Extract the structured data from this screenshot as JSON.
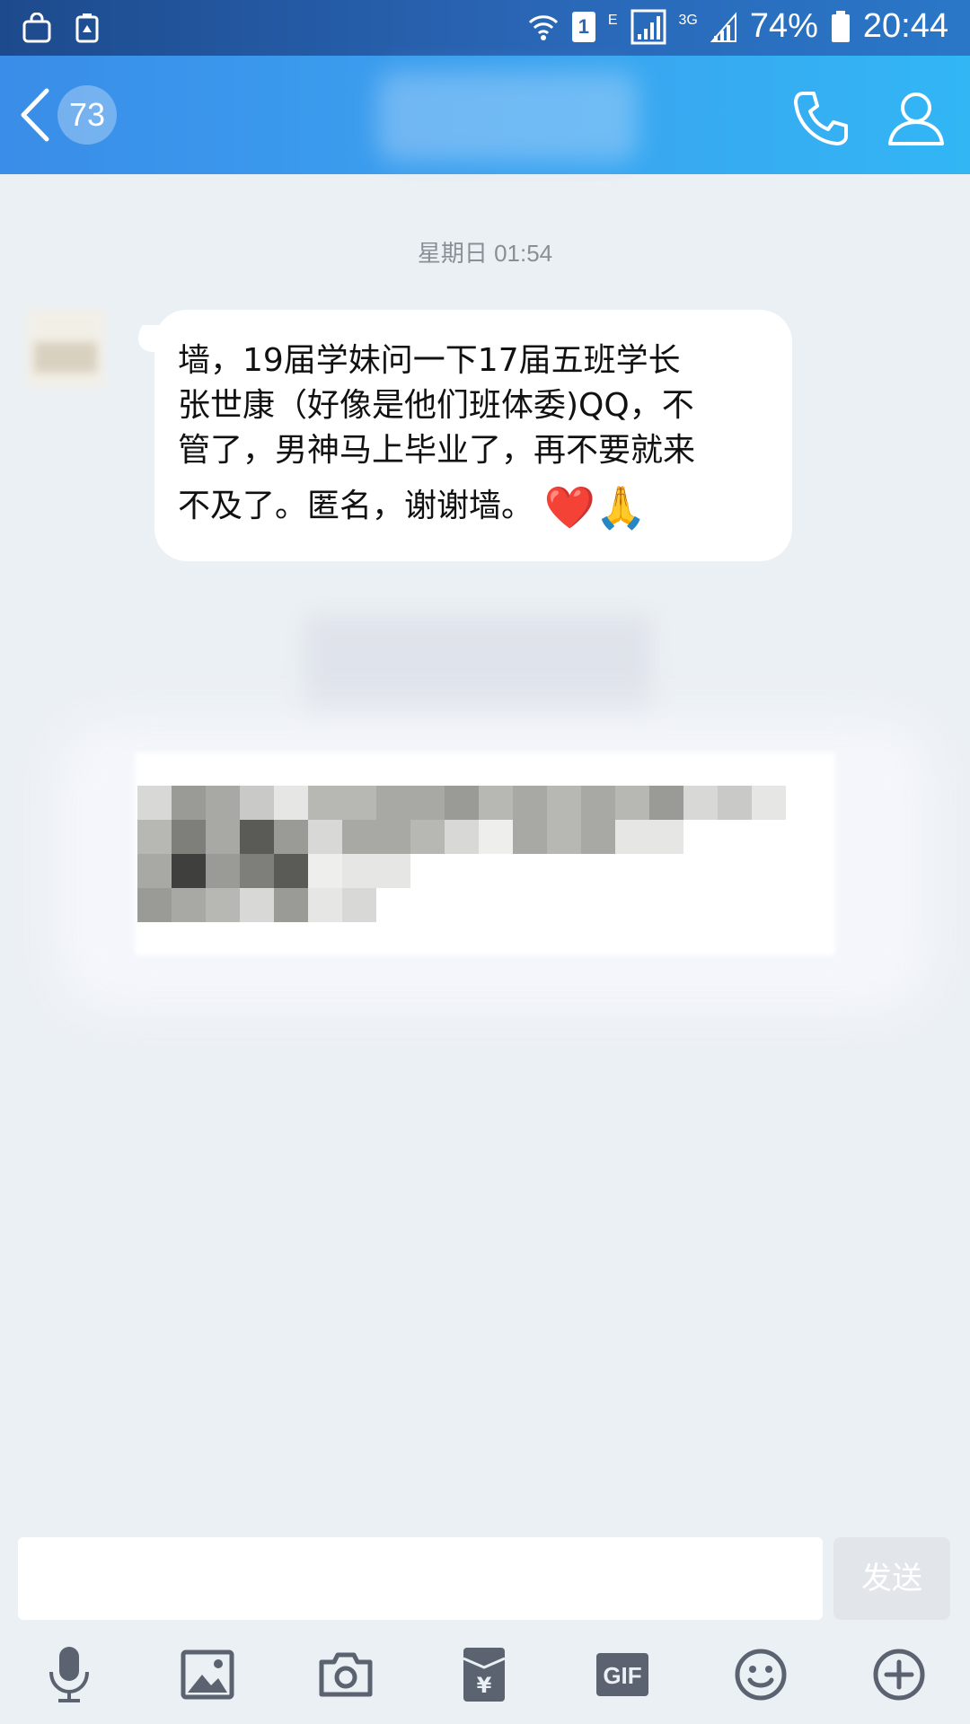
{
  "status_bar": {
    "sim_slot": "1",
    "network_e": "E",
    "network_3g": "3G",
    "battery": "74%",
    "time": "20:44"
  },
  "header": {
    "back_count": "73",
    "icons": [
      "back-arrow-icon",
      "phone-icon",
      "profile-icon"
    ]
  },
  "messages": {
    "timestamp": "星期日 01:54",
    "message_lines": [
      "墙，19届学妹问一下17届五班学长",
      "张世康（好像是他们班体委)QQ，不",
      "管了，男神马上毕业了，再不要就来",
      "不及了。匿名，谢谢墙。"
    ],
    "emojis": [
      "❤️",
      "🙏"
    ]
  },
  "input": {
    "value": "",
    "send_label": "发送"
  },
  "toolbar": {
    "icons": [
      "microphone-icon",
      "image-icon",
      "camera-icon",
      "red-packet-icon",
      "gif-icon",
      "emoji-icon",
      "plus-icon"
    ],
    "gif_label": "GIF",
    "yen": "¥"
  },
  "colors": {
    "header_gradient_start": "#3a8de8",
    "header_gradient_end": "#32b6f4",
    "chat_background": "#ebf0f4",
    "bubble": "#ffffff",
    "toolbar_icon": "#5b6270"
  }
}
